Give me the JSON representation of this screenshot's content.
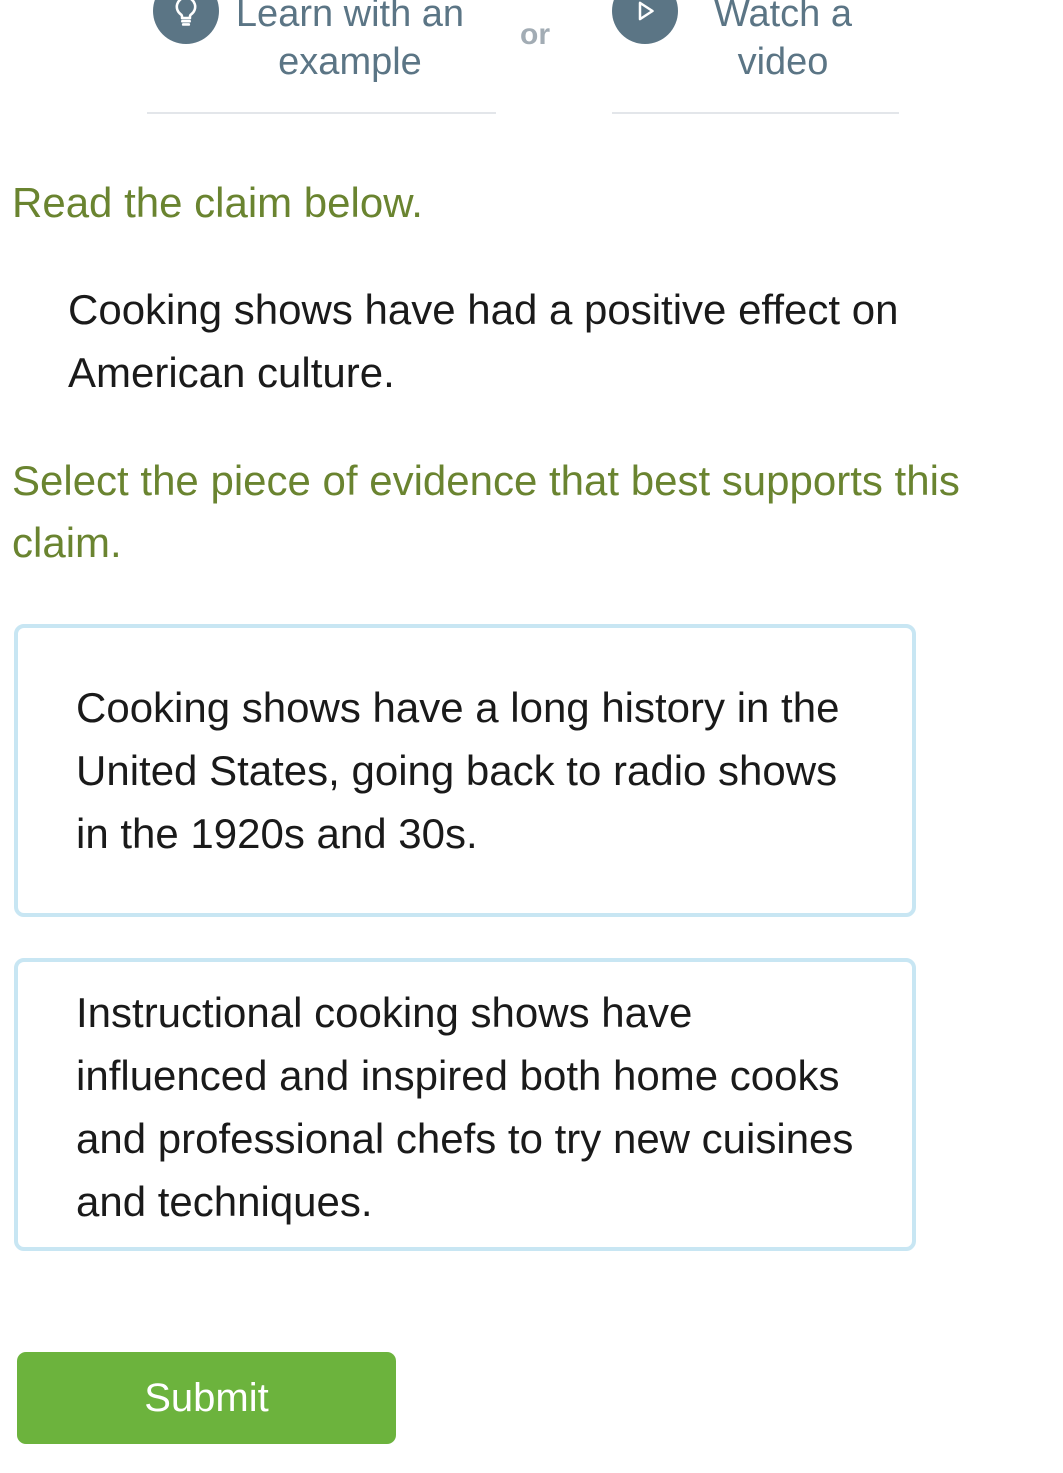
{
  "help": {
    "example": {
      "icon": "lightbulb-icon",
      "label_line1": "Learn with an",
      "label_line2": "example"
    },
    "separator": "or",
    "video": {
      "icon": "play-icon",
      "label_line1": "Watch a",
      "label_line2": "video"
    }
  },
  "question": {
    "instruction_read": "Read the claim below.",
    "claim": "Cooking shows have had a positive effect on American culture.",
    "instruction_select": "Select the piece of evidence that best supports this claim."
  },
  "options": [
    {
      "text": "Cooking shows have a long history in the United States, going back to radio shows in the 1920s and 30s."
    },
    {
      "text": "Instructional cooking shows have influenced and inspired both home cooks and professional chefs to try new cuisines and techniques."
    }
  ],
  "submit": {
    "label": "Submit"
  },
  "colors": {
    "prompt": "#6a8430",
    "help_accent": "#5b7585",
    "option_border": "#c8e6f3",
    "submit_bg": "#6cb33d"
  }
}
